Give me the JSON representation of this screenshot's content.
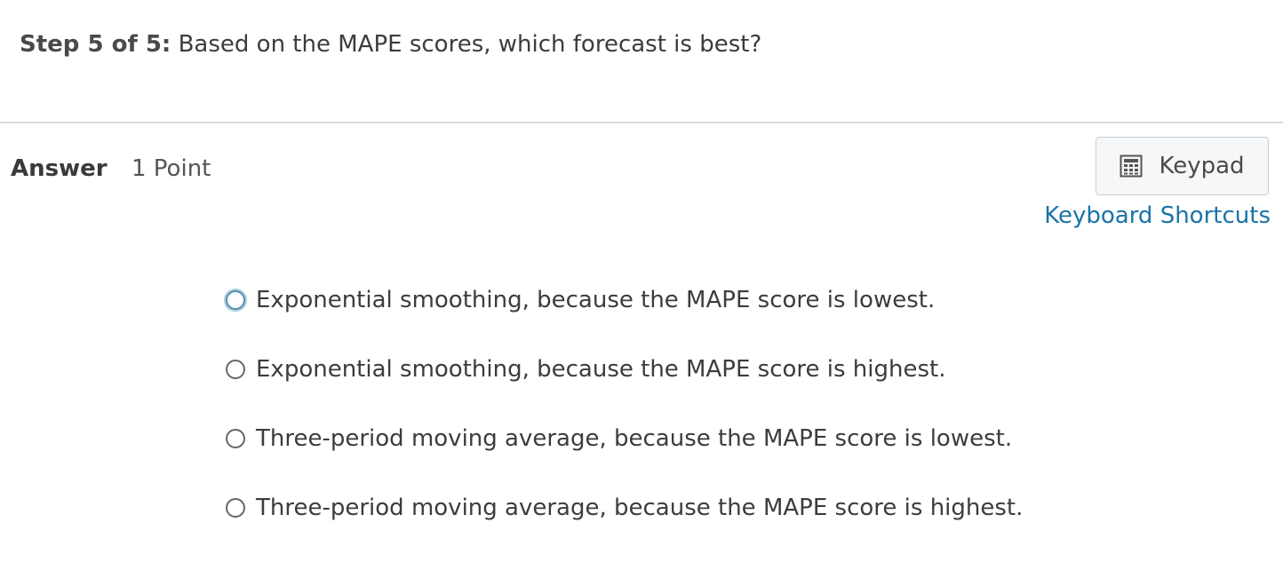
{
  "question": {
    "step_label": "Step 5 of 5:",
    "text": "Based on the MAPE scores, which forecast is best?"
  },
  "answer": {
    "label": "Answer",
    "points": "1 Point"
  },
  "keypad": {
    "label": "Keypad",
    "icon": "calculator-icon"
  },
  "shortcuts": {
    "label": "Keyboard Shortcuts"
  },
  "options": [
    {
      "text": "Exponential smoothing, because the MAPE score is lowest.",
      "selected": false,
      "focused": true
    },
    {
      "text": "Exponential smoothing, because the MAPE score is highest.",
      "selected": false,
      "focused": false
    },
    {
      "text": "Three-period moving average, because the MAPE score is lowest.",
      "selected": false,
      "focused": false
    },
    {
      "text": "Three-period moving average, because the MAPE score is highest.",
      "selected": false,
      "focused": false
    }
  ],
  "colors": {
    "link": "#1a73a8",
    "focus_ring": "#5a8fa8"
  }
}
